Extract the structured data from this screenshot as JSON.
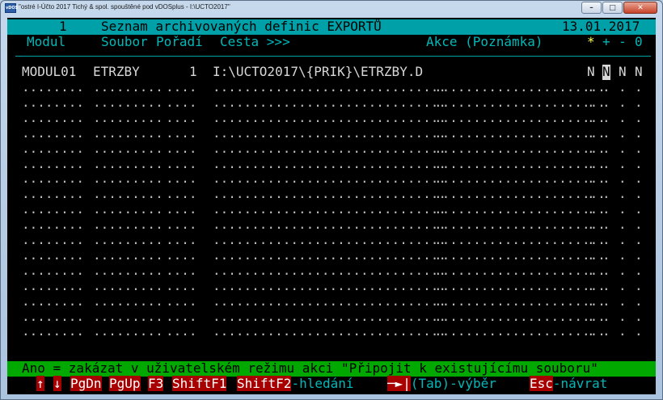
{
  "window": {
    "app_icon": "vDOS",
    "title": "\"ostré I-Účto 2017 Tichý & spol. spouštěné pod vDOSplus - I:\\UCTO2017\"",
    "buttons": {
      "minimize": "–",
      "maximize": "□",
      "close": "✕"
    }
  },
  "header": {
    "number": "1",
    "title": "Seznam archivovaných definic EXPORTŮ",
    "date": "13.01.2017"
  },
  "columns": {
    "modul": "Modul",
    "soubor": "Soubor",
    "poradi": "Pořadí",
    "cesta": "Cesta >>>",
    "akce": "Akce (Poznámka)",
    "flags": [
      "*",
      "+",
      "-",
      "0"
    ]
  },
  "rows": [
    {
      "modul": "MODUL01",
      "soubor": "ETRZBY",
      "poradi": "1",
      "cesta": "I:\\UCTO2017\\{PRIK}\\ETRZBY.D",
      "akce": "",
      "flags": [
        "N",
        "N",
        "N",
        "N"
      ]
    }
  ],
  "empty_row": {
    "modul": "........",
    "soubor": ".........",
    "poradi": "....",
    "cesta": "..............................",
    "akce": "......................",
    "flag": "."
  },
  "status_line": "Ano = zakázat v uživatelském režimu akci \"Připojit k existujícímu souboru\"",
  "function_keys": [
    {
      "key": "↑",
      "label": ""
    },
    {
      "key": "↓",
      "label": ""
    },
    {
      "key": "PgDn",
      "label": ""
    },
    {
      "key": "PgUp",
      "label": ""
    },
    {
      "key": "F3",
      "label": ""
    },
    {
      "key": "ShiftF1",
      "label": ""
    },
    {
      "key": "ShiftF2",
      "label": "-hledání"
    },
    {
      "key": "─►|",
      "label": "(Tab)-výběr"
    },
    {
      "key": "Esc",
      "label": "-návrat"
    }
  ],
  "colors": {
    "header_bg": "#00a0a8",
    "status_bg": "#00a800",
    "key_bg": "#a80000",
    "label_fg": "#00b8b8"
  }
}
